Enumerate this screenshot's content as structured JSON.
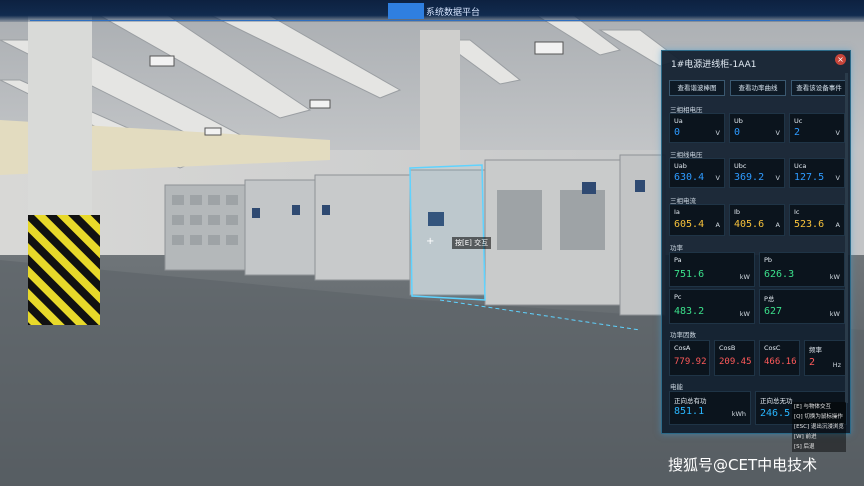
{
  "header": {
    "title": "系统数据平台"
  },
  "hud": {
    "interact_prompt": "按[E] 交互"
  },
  "panel": {
    "title": "1#电源进线柜-1AA1",
    "buttons": [
      "查看谐波棒图",
      "查看功率曲线",
      "查看该设备事件"
    ],
    "sections": {
      "phase_voltage": {
        "label": "三相相电压",
        "items": [
          {
            "name": "Ua",
            "value": "0",
            "unit": "V"
          },
          {
            "name": "Ub",
            "value": "0",
            "unit": "V"
          },
          {
            "name": "Uc",
            "value": "2",
            "unit": "V"
          }
        ]
      },
      "line_voltage": {
        "label": "三相线电压",
        "items": [
          {
            "name": "Uab",
            "value": "630.4",
            "unit": "V"
          },
          {
            "name": "Ubc",
            "value": "369.2",
            "unit": "V"
          },
          {
            "name": "Uca",
            "value": "127.5",
            "unit": "V"
          }
        ]
      },
      "current": {
        "label": "三相电流",
        "items": [
          {
            "name": "Ia",
            "value": "605.4",
            "unit": "A"
          },
          {
            "name": "Ib",
            "value": "405.6",
            "unit": "A"
          },
          {
            "name": "Ic",
            "value": "523.6",
            "unit": "A"
          }
        ]
      },
      "power": {
        "label": "功率",
        "items": [
          {
            "name": "Pa",
            "value": "751.6",
            "unit": "kW"
          },
          {
            "name": "Pb",
            "value": "626.3",
            "unit": "kW"
          },
          {
            "name": "Pc",
            "value": "483.2",
            "unit": "kW"
          },
          {
            "name": "P总",
            "value": "627",
            "unit": "kW"
          }
        ]
      },
      "power_factor": {
        "label": "功率因数",
        "items": [
          {
            "name": "CosA",
            "value": "779.92"
          },
          {
            "name": "CosB",
            "value": "209.45"
          },
          {
            "name": "CosC",
            "value": "466.16"
          },
          {
            "name": "频率",
            "value": "2",
            "unit": "Hz"
          }
        ]
      },
      "energy": {
        "label": "电能",
        "items": [
          {
            "name": "正向总有功",
            "value": "851.1",
            "unit": "kWh"
          },
          {
            "name": "正向总无功",
            "value": "246.5",
            "unit": ""
          }
        ]
      }
    }
  },
  "help": [
    "[E] 与物体交互",
    "[Q] 切换为鼠标操作",
    "[ESC] 退出沉浸浏览",
    "[W] 前进",
    "[S] 后退"
  ],
  "watermark": "搜狐号@CET中电技术"
}
